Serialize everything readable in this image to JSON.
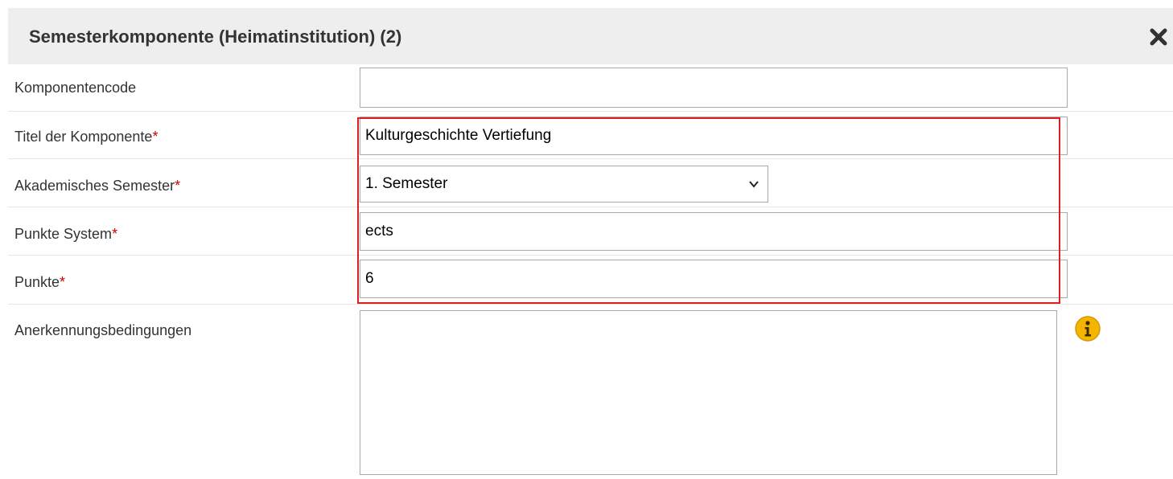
{
  "dialog": {
    "title": "Semesterkomponente (Heimatinstitution) (2)",
    "close_icon": "close-x-icon"
  },
  "fields": {
    "component_code": {
      "label": "Komponentencode",
      "value": ""
    },
    "component_title": {
      "label": "Titel der Komponente",
      "required_mark": "*",
      "value": "Kulturgeschichte Vertiefung"
    },
    "academic_semester": {
      "label": "Akademisches Semester",
      "required_mark": "*",
      "value": "1. Semester"
    },
    "credit_system": {
      "label": "Punkte System",
      "required_mark": "*",
      "value": "ects"
    },
    "credits": {
      "label": "Punkte",
      "required_mark": "*",
      "value": "6"
    },
    "recognition_conditions": {
      "label": "Anerkennungsbedingungen",
      "value": "",
      "info_icon": "info-icon"
    }
  },
  "colors": {
    "header_bg": "#eeeeee",
    "required": "#cc0000",
    "highlight": "#e02020",
    "info": "#f0b400"
  }
}
